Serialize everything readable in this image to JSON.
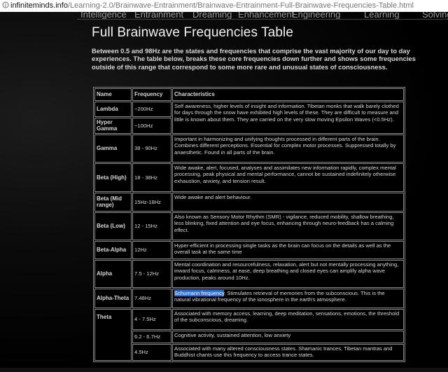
{
  "browser": {
    "url_domain": "infiniteminds.info",
    "url_path": "/Learning-2.0/Brainwave-Entrainment/Brainwave-Entrainment-Full-Brainwave-Frequencies-Table.html"
  },
  "nav": {
    "items": [
      "Intelligence",
      "Entrainment",
      "Dreaming",
      "Enhancement",
      "Engineering",
      "Learning",
      "Solving"
    ]
  },
  "page": {
    "title": "Full Brainwave Frequencies Table",
    "intro": "Between 0.5 and 98Hz are the states and frequencies that comprise the vast majority of our day to day experiences. The table below, breaks these core frequencies down further and shows some frequencies outside of this range that correspond to some more rare and unusual states of consciousness."
  },
  "table": {
    "headers": [
      "Name",
      "Frequency",
      "Characteristics"
    ],
    "rows": [
      {
        "name": "Lambda",
        "range": "~200Hz",
        "chars": "Self awareness, higher levels of insight and information. Tibetan monks that walk barely clothed for days through the snow have exhibited high levels of these. They are difficult to measure and little is known about them. They are carried on the very slow moving Epsilon Waves (<0.5Hz)."
      },
      {
        "name": "Hyper Gamma",
        "range": "~100Hz",
        "chars": ""
      },
      {
        "name": "Gamma",
        "range": "38 - 90Hz",
        "chars": "Important in harmonizing and unifying thoughts processed in different parts of the brain. Combines different perceptions. Essential for complex motor processes. Suppressed totally by anaesthetic. Found in all parts of the brain."
      },
      {
        "name": "Beta (High)",
        "range": "18 - 38Hz",
        "chars": "Wide awake, alert, focused, analyses and assimilates new information rapidly, complex mental processing, peak physical and mental performance, cannot be sustained indefinitely otherwise exhaustion, anxiety, and tension result."
      },
      {
        "name": "Beta (Mid range)",
        "range": "15Hz-18Hz",
        "chars": "Wide awake and alert behaviour."
      },
      {
        "name": "Beta (Low)",
        "range": "12 - 15Hz",
        "chars": "Also known as Sensory Motor Rhythm (SMR) - vigilance, reduced mobility, shallow breathing, less blinking, fixed attention and eye focus, enhancing through neuro-feedback has a calming effect."
      },
      {
        "name": "Beta-Alpha",
        "range": "12Hz",
        "chars": "Hyper-efficient in processing single tasks as the brain can focus on the details as well as the overall task at the same time"
      },
      {
        "name": "Alpha",
        "range": "7.5 - 12Hz",
        "chars": "Mental coordination and resourcefulness, relaxation, alert but not mentally processing anything, inward focus, calmness, at ease, deep breathing and closed eyes can amplify alpha wave production, peaks around 10Hz."
      },
      {
        "name": "Alpha-Theta",
        "range": "7.48Hz",
        "chars_highlight": "Schumann frequency",
        "chars": ". Stimulates retrieval of memories from the subconscious. This is the natural vibrational frequency of the ionosphere in the earth's atmosphere."
      },
      {
        "name": "Theta",
        "range": "4 - 7.5Hz",
        "chars": "Associated with memory access, learning, deep meditation, sensations, emotions, the threshold of the subconscious, dreaming."
      },
      {
        "name": "",
        "range": "6.2 - 6.7Hz",
        "chars": "Cognitive activity, sustained attention, low anxiety"
      },
      {
        "name": "",
        "range": "4.5Hz",
        "chars": "Associated with many altered consciousness states.  Shamanic trances, Tibetan mantras and Buddhist chants use this frequency to access trance states."
      }
    ]
  }
}
